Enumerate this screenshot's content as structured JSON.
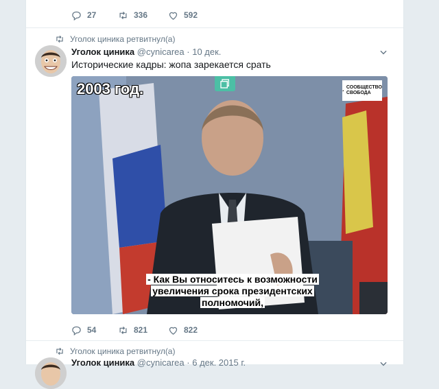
{
  "tweet_prev": {
    "replies": "27",
    "retweets": "336",
    "likes": "592"
  },
  "tweet1": {
    "retweet_label": "Уголок циника ретвитнул(а)",
    "author_name": "Уголок циника",
    "author_handle": "@cynicarea",
    "separator": "·",
    "date": "10 дек.",
    "text": "Исторические кадры: жопа зарекается срать",
    "media": {
      "year_overlay": "2003 год.",
      "badge_line1": "СООБЩЕСТВО",
      "badge_line2": "СВОБОДА",
      "subtitle_line1": "- Как Вы относитесь к возможности",
      "subtitle_line2": "увеличения срока президентских",
      "subtitle_line3": "полномочий,"
    },
    "replies": "54",
    "retweets": "821",
    "likes": "822"
  },
  "tweet2": {
    "retweet_label": "Уголок циника ретвитнул(а)",
    "author_name": "Уголок циника",
    "author_handle": "@cynicarea",
    "separator": "·",
    "date": "6 дек. 2015 г."
  },
  "colors": {
    "accent_gif": "#4cbfa5",
    "muted": "#657786",
    "background": "#e6ecf0"
  },
  "icons": [
    "reply-icon",
    "retweet-icon",
    "like-icon",
    "chevron-down-icon",
    "gif-icon"
  ]
}
